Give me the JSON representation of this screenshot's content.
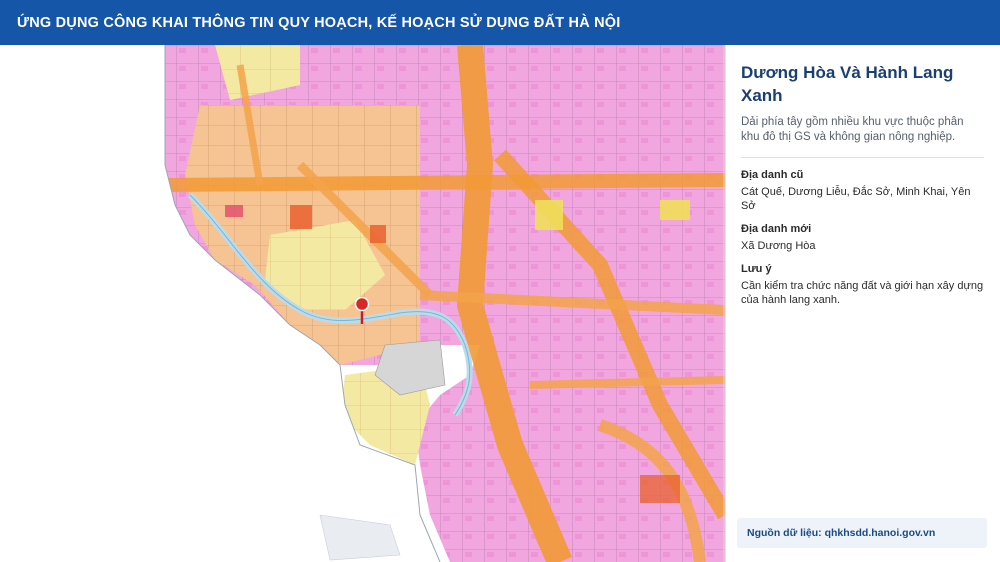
{
  "header": {
    "title": "ỨNG DỤNG CÔNG KHAI THÔNG TIN QUY HOẠCH, KẾ HOẠCH SỬ DỤNG ĐẤT HÀ NỘI"
  },
  "map": {
    "pin_color": "#d62828",
    "land_colors": {
      "residential": "#f2a6e0",
      "mixed": "#f6c68f",
      "road": "#f5a64a",
      "agriculture": "#f5eba8",
      "public": "#d8d8d8",
      "water": "#cfe6f2"
    }
  },
  "info": {
    "title": "Dương Hòa Và Hành Lang Xanh",
    "description": "Dải phía tây gồm nhiều khu vực thuộc phân khu đô thị GS và không gian nông nghiệp.",
    "fields": [
      {
        "label": "Địa danh cũ",
        "value": "Cát Quế, Dương Liễu, Đắc Sở, Minh Khai, Yên Sở"
      },
      {
        "label": "Địa danh mới",
        "value": "Xã Dương Hòa"
      },
      {
        "label": "Lưu ý",
        "value": "Cần kiểm tra chức năng đất và giới hạn xây dựng của hành lang xanh."
      }
    ]
  },
  "source": {
    "text": "Nguồn dữ liệu: qhkhsdd.hanoi.gov.vn"
  },
  "colors": {
    "header_bg": "#1556a8",
    "title_text": "#1a3f73"
  }
}
